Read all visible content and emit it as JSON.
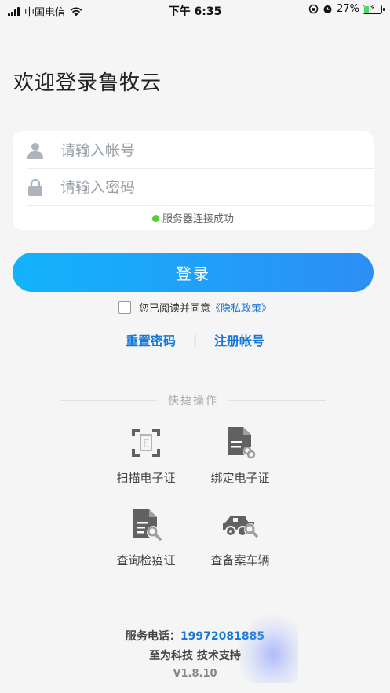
{
  "status_bar": {
    "carrier": "中国电信",
    "time": "下午 6:35",
    "battery_percent": "27%",
    "battery_level": 0.27
  },
  "page": {
    "title": "欢迎登录鲁牧云"
  },
  "login_form": {
    "account_placeholder": "请输入帐号",
    "password_placeholder": "请输入密码",
    "server_status": "服务器连接成功"
  },
  "login_button": "登录",
  "privacy": {
    "agree_text": "您已阅读并同意",
    "policy_link": "《隐私政策》",
    "checked": false
  },
  "links": {
    "reset_password": "重置密码",
    "separator": "|",
    "register": "注册帐号"
  },
  "quick_actions": {
    "title": "快捷操作",
    "items": [
      {
        "label": "扫描电子证",
        "icon": "scan-icon"
      },
      {
        "label": "绑定电子证",
        "icon": "document-link-icon"
      },
      {
        "label": "查询检疫证",
        "icon": "document-search-icon"
      },
      {
        "label": "查备案车辆",
        "icon": "vehicle-search-icon"
      }
    ]
  },
  "footer": {
    "phone_label": "服务电话：",
    "phone_number": "19972081885",
    "support": "至为科技 技术支持",
    "version": "V1.8.10"
  },
  "colors": {
    "accent": "#1677d8",
    "button_start": "#12b3fb",
    "button_end": "#2d8ef5",
    "success_dot": "#52d02c"
  }
}
